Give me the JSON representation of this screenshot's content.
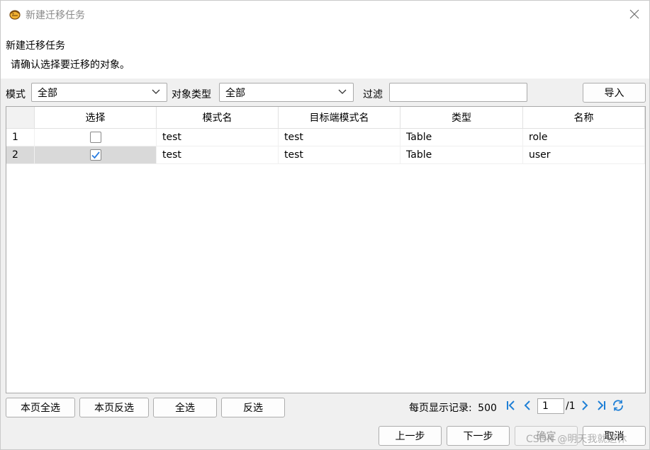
{
  "window": {
    "title": "新建迁移任务"
  },
  "header": {
    "title": "新建迁移任务",
    "subtitle": "请确认选择要迁移的对象。"
  },
  "filters": {
    "mode_label": "模式",
    "mode_value": "全部",
    "objtype_label": "对象类型",
    "objtype_value": "全部",
    "filter_label": "过滤",
    "filter_value": "",
    "import_label": "导入"
  },
  "table": {
    "columns": [
      "选择",
      "模式名",
      "目标端模式名",
      "类型",
      "名称"
    ],
    "rows": [
      {
        "num": "1",
        "checked": false,
        "schema": "test",
        "target_schema": "test",
        "type": "Table",
        "name": "role"
      },
      {
        "num": "2",
        "checked": true,
        "schema": "test",
        "target_schema": "test",
        "type": "Table",
        "name": "user"
      }
    ]
  },
  "selection_buttons": {
    "page_select_all": "本页全选",
    "page_invert": "本页反选",
    "select_all": "全选",
    "invert": "反选"
  },
  "pager": {
    "label": "每页显示记录:",
    "page_size": "500",
    "current_page": "1",
    "total": "/1"
  },
  "nav_buttons": {
    "prev": "上一步",
    "next": "下一步",
    "ok": "确定",
    "cancel": "取消"
  },
  "watermark": "CSDN @明天我就退休",
  "colors": {
    "accent": "#1e7fd6",
    "check": "#2a7de1",
    "title_gray": "#8a8a8a"
  }
}
